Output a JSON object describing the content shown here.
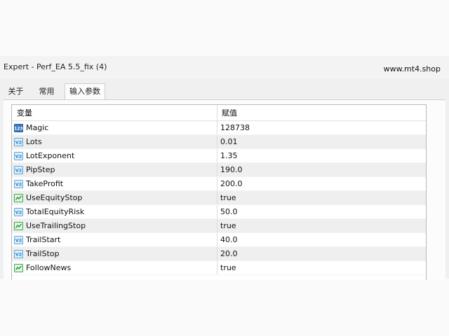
{
  "window": {
    "title": "Expert - Perf_EA 5.5_fix (4)",
    "watermark": "www.mt4.shop"
  },
  "tabs": [
    {
      "label": "关于",
      "active": false
    },
    {
      "label": "常用",
      "active": false
    },
    {
      "label": "输入参数",
      "active": true
    }
  ],
  "table": {
    "columns": [
      "变量",
      "赋值"
    ],
    "rows": [
      {
        "name": "Magic",
        "value": "128738",
        "icon": "int-123-icon"
      },
      {
        "name": "Lots",
        "value": "0.01",
        "icon": "double-icon"
      },
      {
        "name": "LotExponent",
        "value": "1.35",
        "icon": "double-icon"
      },
      {
        "name": "PipStep",
        "value": "190.0",
        "icon": "double-icon"
      },
      {
        "name": "TakeProfit",
        "value": "200.0",
        "icon": "double-icon"
      },
      {
        "name": "UseEquityStop",
        "value": "true",
        "icon": "bool-icon"
      },
      {
        "name": "TotalEquityRisk",
        "value": "50.0",
        "icon": "double-icon"
      },
      {
        "name": "UseTrailingStop",
        "value": "true",
        "icon": "bool-icon"
      },
      {
        "name": "TrailStart",
        "value": "40.0",
        "icon": "double-icon"
      },
      {
        "name": "TrailStop",
        "value": "20.0",
        "icon": "double-icon"
      },
      {
        "name": "FollowNews",
        "value": "true",
        "icon": "bool-icon"
      }
    ]
  },
  "colors": {
    "int_icon": "#3a78c8",
    "double_icon": "#5aa6dc",
    "bool_icon": "#3aa84a"
  }
}
